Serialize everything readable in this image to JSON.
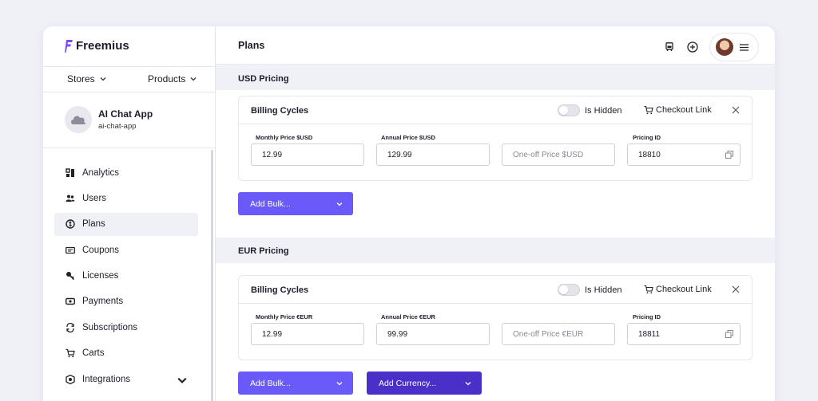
{
  "brand": {
    "name": "Freemius"
  },
  "sidebar": {
    "stores_label": "Stores",
    "products_label": "Products",
    "app": {
      "name": "AI Chat App",
      "slug": "ai-chat-app"
    },
    "items": [
      {
        "label": "Analytics",
        "icon": "analytics-icon"
      },
      {
        "label": "Users",
        "icon": "users-icon"
      },
      {
        "label": "Plans",
        "icon": "plans-icon",
        "active": true
      },
      {
        "label": "Coupons",
        "icon": "coupons-icon"
      },
      {
        "label": "Licenses",
        "icon": "key-icon"
      },
      {
        "label": "Payments",
        "icon": "payments-icon"
      },
      {
        "label": "Subscriptions",
        "icon": "subscriptions-icon"
      },
      {
        "label": "Carts",
        "icon": "cart-icon"
      },
      {
        "label": "Integrations",
        "icon": "integrations-icon"
      }
    ]
  },
  "header": {
    "title": "Plans"
  },
  "usd": {
    "section_title": "USD Pricing",
    "card_title": "Billing Cycles",
    "hidden_label": "Is Hidden",
    "checkout_label": "Checkout Link",
    "monthly_label": "Monthly Price $USD",
    "monthly_value": "12.99",
    "annual_label": "Annual Price $USD",
    "annual_value": "129.99",
    "oneoff_placeholder": "One-off Price $USD",
    "pricing_id_label": "Pricing ID",
    "pricing_id_value": "18810",
    "add_bulk_label": "Add Bulk..."
  },
  "eur": {
    "section_title": "EUR Pricing",
    "card_title": "Billing Cycles",
    "hidden_label": "Is Hidden",
    "checkout_label": "Checkout Link",
    "monthly_label": "Monthly Price €EUR",
    "monthly_value": "12.99",
    "annual_label": "Annual Price €EUR",
    "annual_value": "99.99",
    "oneoff_placeholder": "One-off Price €EUR",
    "pricing_id_label": "Pricing ID",
    "pricing_id_value": "18811",
    "add_bulk_label": "Add Bulk...",
    "add_currency_label": "Add Currency..."
  },
  "colors": {
    "accent": "#6a5af9",
    "accent_dark": "#4a2fc8",
    "background": "#f0f0f7"
  }
}
